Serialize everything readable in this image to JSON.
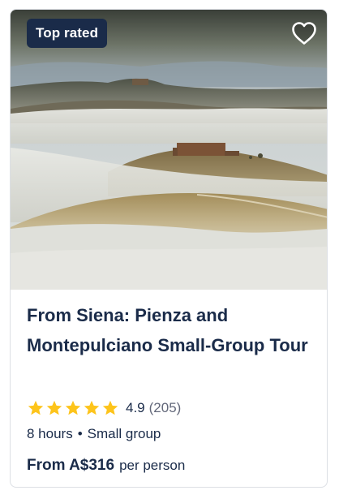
{
  "badge": {
    "label": "Top rated"
  },
  "wishlist": {
    "icon": "heart-icon"
  },
  "tour": {
    "title": "From Siena: Pienza and Montepulciano Small-Group Tour",
    "rating": {
      "stars": 5,
      "value": "4.9",
      "count": "(205)",
      "star_icon": "star-icon",
      "star_color": "#fdc41b"
    },
    "duration": "8 hours",
    "separator": "•",
    "group": "Small group",
    "price": {
      "from": "From A$316",
      "suffix": "per person"
    }
  },
  "colors": {
    "brand_navy": "#1a2b49",
    "muted_text": "#63687a",
    "border": "#dcdfe4"
  }
}
